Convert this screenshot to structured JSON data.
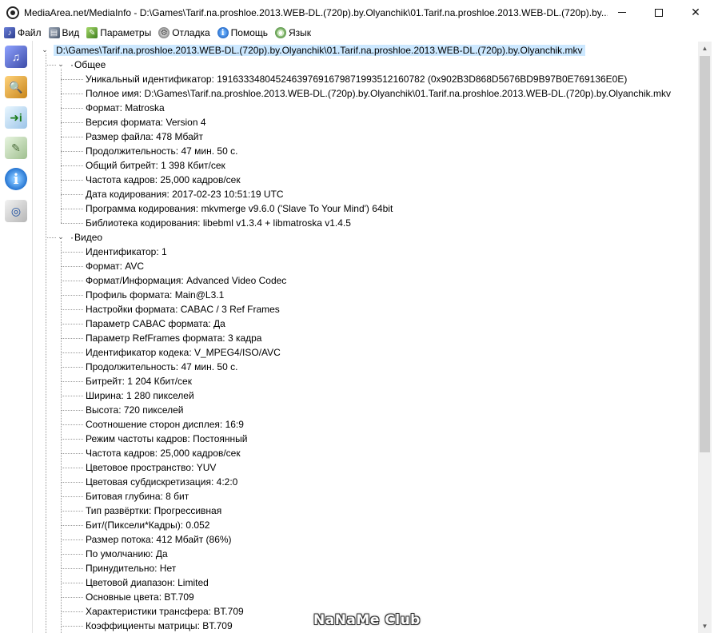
{
  "window": {
    "title": "MediaArea.net/MediaInfo - D:\\Games\\Tarif.na.proshloe.2013.WEB-DL.(720p).by.Olyanchik\\01.Tarif.na.proshloe.2013.WEB-DL.(720p).by....",
    "minimize_label": "–",
    "maximize_label": "□",
    "close_label": "✕"
  },
  "menu": {
    "items": [
      {
        "label": "Файл",
        "icon": "file-icon"
      },
      {
        "label": "Вид",
        "icon": "view-icon"
      },
      {
        "label": "Параметры",
        "icon": "params-icon"
      },
      {
        "label": "Отладка",
        "icon": "debug-icon"
      },
      {
        "label": "Помощь",
        "icon": "help-icon"
      },
      {
        "label": "Язык",
        "icon": "language-icon"
      }
    ]
  },
  "toolbar": {
    "buttons": [
      {
        "icon": "open-file-icon",
        "glyph": "♫"
      },
      {
        "icon": "open-folder-icon",
        "glyph": "🔍"
      },
      {
        "icon": "export-icon",
        "glyph": "➜i"
      },
      {
        "icon": "settings-icon",
        "glyph": "✎"
      },
      {
        "icon": "about-icon",
        "glyph": "i"
      },
      {
        "icon": "web-icon",
        "glyph": "◎"
      }
    ]
  },
  "tree": {
    "root": "D:\\Games\\Tarif.na.proshloe.2013.WEB-DL.(720p).by.Olyanchik\\01.Tarif.na.proshloe.2013.WEB-DL.(720p).by.Olyanchik.mkv",
    "sections": [
      {
        "name": "Общее",
        "items": [
          "Уникальный идентификатор: 191633348045246397691679871993512160782 (0x902B3D868D5676BD9B97B0E769136E0E)",
          "Полное имя: D:\\Games\\Tarif.na.proshloe.2013.WEB-DL.(720p).by.Olyanchik\\01.Tarif.na.proshloe.2013.WEB-DL.(720p).by.Olyanchik.mkv",
          "Формат: Matroska",
          "Версия формата: Version 4",
          "Размер файла: 478 Мбайт",
          "Продолжительность: 47 мин. 50 с.",
          "Общий битрейт: 1 398 Кбит/сек",
          "Частота кадров: 25,000 кадров/сек",
          "Дата кодирования: 2017-02-23 10:51:19 UTC",
          "Программа кодирования: mkvmerge v9.6.0 ('Slave To Your Mind') 64bit",
          "Библиотека кодирования: libebml v1.3.4 + libmatroska v1.4.5"
        ]
      },
      {
        "name": "Видео",
        "items": [
          "Идентификатор: 1",
          "Формат: AVC",
          "Формат/Информация: Advanced Video Codec",
          "Профиль формата: Main@L3.1",
          "Настройки формата: CABAC / 3 Ref Frames",
          "Параметр CABAC формата: Да",
          "Параметр RefFrames формата: 3 кадра",
          "Идентификатор кодека: V_MPEG4/ISO/AVC",
          "Продолжительность: 47 мин. 50 с.",
          "Битрейт: 1 204 Кбит/сек",
          "Ширина: 1 280 пикселей",
          "Высота: 720 пикселей",
          "Соотношение сторон дисплея: 16:9",
          "Режим частоты кадров: Постоянный",
          "Частота кадров: 25,000 кадров/сек",
          "Цветовое пространство: YUV",
          "Цветовая субдискретизация: 4:2:0",
          "Битовая глубина: 8 бит",
          "Тип развёртки: Прогрессивная",
          "Бит/(Пиксели*Кадры): 0.052",
          "Размер потока: 412 Мбайт (86%)",
          "По умолчанию: Да",
          "Принудительно: Нет",
          "Цветовой диапазон: Limited",
          "Основные цвета: BT.709",
          "Характеристики трансфера: BT.709",
          "Коэффициенты матрицы: BT.709"
        ]
      }
    ]
  },
  "watermark": "NaNaMe Club"
}
